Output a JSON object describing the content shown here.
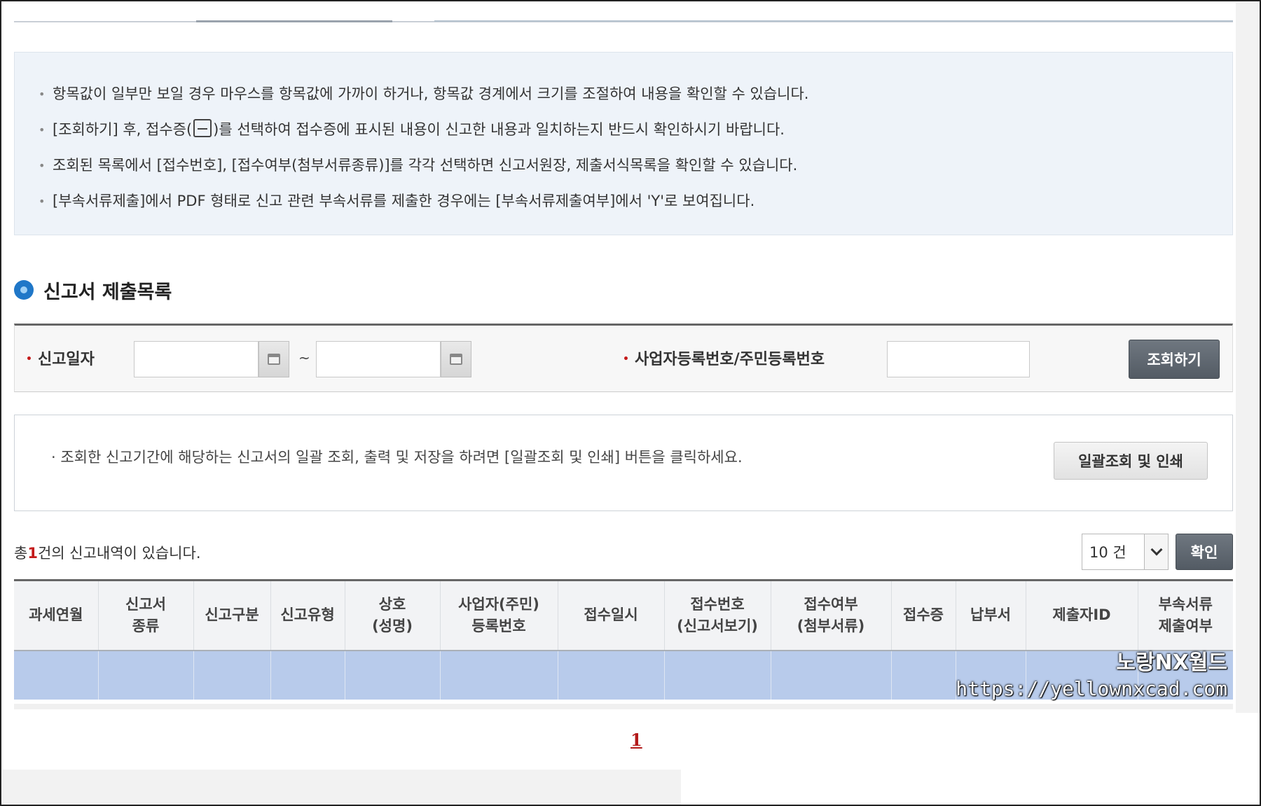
{
  "info": {
    "lines": [
      "항목값이 일부만 보일 경우 마우스를 항목값에 가까이 하거나, 항목값 경계에서 크기를 조절하여 내용을 확인할 수 있습니다.",
      "[조회하기] 후, 접수증(",
      ")를 선택하여 접수증에 표시된 내용이 신고한 내용과 일치하는지 반드시 확인하시기 바랍니다.",
      "조회된 목록에서 [접수번호], [접수여부(첨부서류종류)]를 각각 선택하면 신고서원장, 제출서식목록을 확인할 수 있습니다.",
      "[부속서류제출]에서 PDF 형태로 신고 관련 부속서류를 제출한 경우에는 [부속서류제출여부]에서 'Y'로 보여집니다."
    ]
  },
  "section": {
    "title": "신고서 제출목록"
  },
  "search": {
    "date_label": "신고일자",
    "date_from": "",
    "date_to": "",
    "tilde": "~",
    "biz_label": "사업자등록번호/주민등록번호",
    "biz_value": "",
    "search_button": "조회하기",
    "required_mark": "•"
  },
  "bulk": {
    "text": "· 조회한 신고기간에 해당하는 신고서의 일괄 조회, 출력 및 저장을 하려면 [일괄조회 및 인쇄] 버튼을 클릭하세요.",
    "button": "일괄조회 및 인쇄"
  },
  "results": {
    "count_prefix": "총",
    "count": "1",
    "count_suffix": "건의 신고내역이 있습니다.",
    "page_size": "10 건",
    "confirm_button": "확인"
  },
  "table": {
    "headers": [
      "과세연월",
      "신고서\n종류",
      "신고구분",
      "신고유형",
      "상호\n(성명)",
      "사업자(주민)\n등록번호",
      "접수일시",
      "접수번호\n(신고서보기)",
      "접수여부\n(첨부서류)",
      "접수증",
      "납부서",
      "제출자ID",
      "부속서류\n제출여부"
    ]
  },
  "pagination": {
    "current": "1"
  },
  "watermark": {
    "title": "노랑NX월드",
    "url": "https://yellownxcad.com"
  }
}
